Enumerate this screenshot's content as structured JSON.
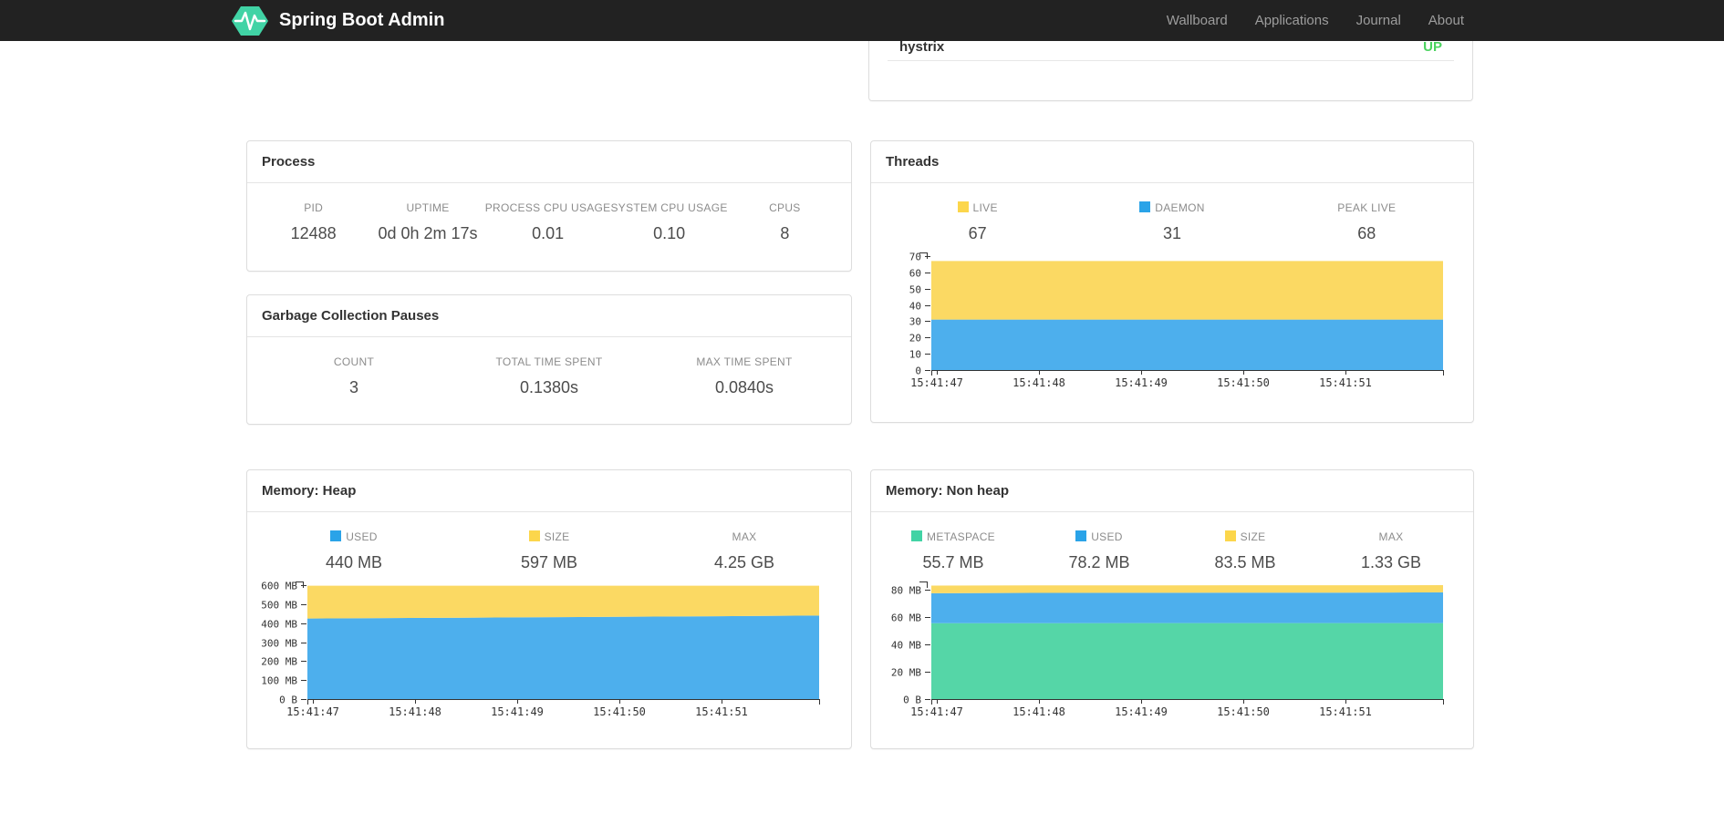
{
  "navbar": {
    "brand": "Spring Boot Admin",
    "logo_color": "#41d3a5",
    "bg": "#222222",
    "items": [
      {
        "label": "Wallboard"
      },
      {
        "label": "Applications"
      },
      {
        "label": "Journal"
      },
      {
        "label": "About"
      }
    ]
  },
  "health_panel": {
    "row": {
      "name": "hystrix",
      "status": "UP",
      "status_color": "#4bd35f"
    }
  },
  "process_panel": {
    "title": "Process",
    "metrics": [
      {
        "label": "PID",
        "value": "12488"
      },
      {
        "label": "UPTIME",
        "value": "0d 0h 2m 17s"
      },
      {
        "label": "PROCESS CPU USAGE",
        "value": "0.01"
      },
      {
        "label": "SYSTEM CPU USAGE",
        "value": "0.10"
      },
      {
        "label": "CPUS",
        "value": "8"
      }
    ]
  },
  "gc_panel": {
    "title": "Garbage Collection Pauses",
    "metrics": [
      {
        "label": "COUNT",
        "value": "3"
      },
      {
        "label": "TOTAL TIME SPENT",
        "value": "0.1380s"
      },
      {
        "label": "MAX TIME SPENT",
        "value": "0.0840s"
      }
    ]
  },
  "threads_panel": {
    "title": "Threads",
    "metrics": [
      {
        "label": "LIVE",
        "value": "67",
        "swatch": "#fcd64b"
      },
      {
        "label": "DAEMON",
        "value": "31",
        "swatch": "#2aa3e8"
      },
      {
        "label": "PEAK LIVE",
        "value": "68"
      }
    ]
  },
  "heap_panel": {
    "title": "Memory: Heap",
    "metrics": [
      {
        "label": "USED",
        "value": "440 MB",
        "swatch": "#2aa3e8"
      },
      {
        "label": "SIZE",
        "value": "597 MB",
        "swatch": "#fcd64b"
      },
      {
        "label": "MAX",
        "value": "4.25 GB"
      }
    ]
  },
  "nonheap_panel": {
    "title": "Memory: Non heap",
    "metrics": [
      {
        "label": "METASPACE",
        "value": "55.7 MB",
        "swatch": "#42d3a5"
      },
      {
        "label": "USED",
        "value": "78.2 MB",
        "swatch": "#2aa3e8"
      },
      {
        "label": "SIZE",
        "value": "83.5 MB",
        "swatch": "#fcd64b"
      },
      {
        "label": "MAX",
        "value": "1.33 GB"
      }
    ]
  },
  "chart_data": [
    {
      "id": "threads",
      "type": "area",
      "title": "Threads",
      "stacked_cumulative": true,
      "x_labels": [
        "15:41:47",
        "15:41:48",
        "15:41:49",
        "15:41:50",
        "15:41:51"
      ],
      "x_range": [
        "15:41:47",
        "15:41:52"
      ],
      "ymax": 70,
      "y_ticks": [
        {
          "v": 0,
          "label": "0"
        },
        {
          "v": 10,
          "label": "10"
        },
        {
          "v": 20,
          "label": "20"
        },
        {
          "v": 30,
          "label": "30"
        },
        {
          "v": 40,
          "label": "40"
        },
        {
          "v": 50,
          "label": "50"
        },
        {
          "v": 60,
          "label": "60"
        },
        {
          "v": 70,
          "label": "70"
        }
      ],
      "series": [
        {
          "name": "DAEMON",
          "fill": "#4dafed",
          "values": [
            31,
            31,
            31,
            31,
            31,
            31
          ]
        },
        {
          "name": "LIVE",
          "fill": "#fbd963",
          "values": [
            67,
            67,
            67,
            67,
            67,
            67
          ]
        }
      ]
    },
    {
      "id": "memory-heap",
      "type": "area",
      "title": "Memory: Heap",
      "stacked_cumulative": true,
      "x_labels": [
        "15:41:47",
        "15:41:48",
        "15:41:49",
        "15:41:50",
        "15:41:51"
      ],
      "x_range": [
        "15:41:47",
        "15:41:52"
      ],
      "ymax": 600,
      "y_ticks": [
        {
          "v": 0,
          "label": "0 B"
        },
        {
          "v": 100,
          "label": "100 MB"
        },
        {
          "v": 200,
          "label": "200 MB"
        },
        {
          "v": 300,
          "label": "300 MB"
        },
        {
          "v": 400,
          "label": "400 MB"
        },
        {
          "v": 500,
          "label": "500 MB"
        },
        {
          "v": 600,
          "label": "600 MB"
        }
      ],
      "series": [
        {
          "name": "USED",
          "fill": "#4dafed",
          "values": [
            424,
            427,
            430,
            433,
            436,
            440
          ]
        },
        {
          "name": "SIZE",
          "fill": "#fbd963",
          "values": [
            597,
            597,
            597,
            597,
            597,
            597
          ]
        }
      ]
    },
    {
      "id": "memory-nonheap",
      "type": "area",
      "title": "Memory: Non heap",
      "stacked_cumulative": true,
      "x_labels": [
        "15:41:47",
        "15:41:48",
        "15:41:49",
        "15:41:50",
        "15:41:51"
      ],
      "x_range": [
        "15:41:47",
        "15:41:52"
      ],
      "ymax": 83.5,
      "y_ticks": [
        {
          "v": 0,
          "label": "0 B"
        },
        {
          "v": 20,
          "label": "20 MB"
        },
        {
          "v": 40,
          "label": "40 MB"
        },
        {
          "v": 60,
          "label": "60 MB"
        },
        {
          "v": 80,
          "label": "80 MB"
        }
      ],
      "series": [
        {
          "name": "METASPACE",
          "fill": "#55d6a7",
          "values": [
            55.6,
            55.6,
            55.7,
            55.7,
            55.7,
            55.7
          ]
        },
        {
          "name": "USED",
          "fill": "#4dafed",
          "values": [
            77.6,
            77.8,
            77.9,
            78.0,
            78.0,
            78.2
          ]
        },
        {
          "name": "SIZE",
          "fill": "#fbd963",
          "values": [
            83.2,
            83.3,
            83.3,
            83.4,
            83.4,
            83.5
          ]
        }
      ]
    }
  ]
}
